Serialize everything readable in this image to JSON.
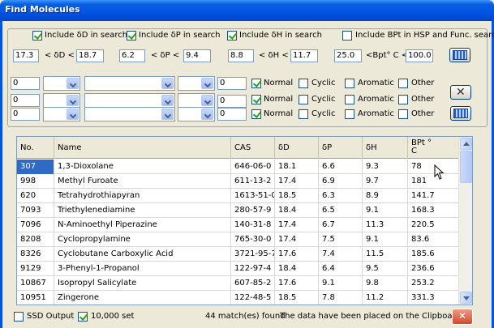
{
  "window": {
    "title": "Find Molecules"
  },
  "search_flags": {
    "include_d": {
      "label": "Include δD in search",
      "checked": true
    },
    "include_p": {
      "label": "Include δP in search",
      "checked": true
    },
    "include_h": {
      "label": "Include δH in search",
      "checked": true
    },
    "include_bpt": {
      "label": "Include BPt in HSP and Func. search",
      "checked": false
    }
  },
  "ranges": {
    "d_min": "17.3",
    "d_label": "< δD <",
    "d_max": "18.7",
    "p_min": "6.2",
    "p_label": "< δP <",
    "p_max": "9.4",
    "h_min": "8.8",
    "h_label": "< δH <",
    "h_max": "11.7",
    "bpt_min": "25.0",
    "bpt_label": "<Bpt° C <",
    "bpt_max": "100.0"
  },
  "group_rows": [
    {
      "count": "0",
      "count2": "0",
      "normal": {
        "label": "Normal",
        "checked": true
      },
      "cyclic": {
        "label": "Cyclic",
        "checked": false
      },
      "aromatic": {
        "label": "Aromatic",
        "checked": false
      },
      "other": {
        "label": "Other",
        "checked": false
      }
    },
    {
      "count": "0",
      "count2": "0",
      "normal": {
        "label": "Normal",
        "checked": true
      },
      "cyclic": {
        "label": "Cyclic",
        "checked": false
      },
      "aromatic": {
        "label": "Aromatic",
        "checked": false
      },
      "other": {
        "label": "Other",
        "checked": false
      }
    },
    {
      "count": "0",
      "count2": "0",
      "normal": {
        "label": "Normal",
        "checked": true
      },
      "cyclic": {
        "label": "Cyclic",
        "checked": false
      },
      "aromatic": {
        "label": "Aromatic",
        "checked": false
      },
      "other": {
        "label": "Other",
        "checked": false
      }
    }
  ],
  "table": {
    "columns": [
      "No.",
      "Name",
      "CAS",
      "δD",
      "δP",
      "δH",
      "BPt °",
      "C"
    ],
    "rows": [
      [
        "307",
        "1,3-Dioxolane",
        "646-06-0",
        "18.1",
        "6.6",
        "9.3",
        "78"
      ],
      [
        "998",
        "Methyl Furoate",
        "611-13-2",
        "17.4",
        "6.9",
        "9.7",
        "181"
      ],
      [
        "620",
        "Tetrahydrothiapyran",
        "1613-51-0",
        "18.5",
        "6.3",
        "8.9",
        "141.7"
      ],
      [
        "7093",
        "Triethylenediamine",
        "280-57-9",
        "18.4",
        "6.5",
        "9.1",
        "168.3"
      ],
      [
        "7096",
        "N-Aminoethyl Piperazine",
        "140-31-8",
        "17.4",
        "6.7",
        "11.3",
        "220.5"
      ],
      [
        "8208",
        "Cyclopropylamine",
        "765-30-0",
        "17.4",
        "7.5",
        "9.1",
        "83.6"
      ],
      [
        "8326",
        "Cyclobutane Carboxylic Acid",
        "3721-95-7",
        "17.6",
        "7.4",
        "11.5",
        "185.6"
      ],
      [
        "9129",
        "3-Phenyl-1-Propanol",
        "122-97-4",
        "18.4",
        "6.4",
        "9.5",
        "236.6"
      ],
      [
        "10867",
        "Isopropyl Salicylate",
        "607-85-2",
        "17.6",
        "9.1",
        "9.8",
        "253.2"
      ],
      [
        "10951",
        "Zingerone",
        "122-48-5",
        "18.5",
        "7.8",
        "11.2",
        "331.3"
      ]
    ]
  },
  "status": {
    "ssd_output": {
      "label": "SSD Output",
      "checked": false
    },
    "set_10000": {
      "label": "10,000 set",
      "checked": true
    },
    "matches": "44 match(es) found",
    "clipboard": "The data have been placed on the Clipboard"
  },
  "icons": {
    "calculator_1": "calculator-icon",
    "clear": "close-icon",
    "calculator_2": "calculator-icon",
    "exit": "close-icon"
  },
  "colors": {
    "titlebar": "#0054e3",
    "selection": "#316ac5",
    "check": "#21a121"
  }
}
